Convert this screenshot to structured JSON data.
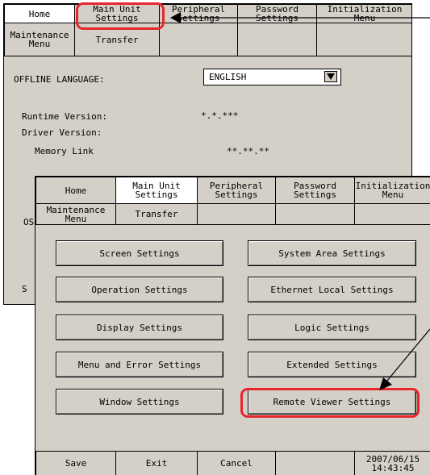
{
  "back": {
    "tabs_row1": [
      "Home",
      "Main Unit\nSettings",
      "Peripheral\nSettings",
      "Password\nSettings",
      "Initialization\nMenu"
    ],
    "tabs_row2": [
      "Maintenance\nMenu",
      "Transfer",
      "",
      "",
      ""
    ],
    "offline_language_label": "OFFLINE LANGUAGE:",
    "offline_language_value": "ENGLISH",
    "runtime_version_label": "Runtime Version:",
    "runtime_version_value": "*.*.***",
    "driver_version_label": "Driver Version:",
    "memory_link_label": "Memory Link",
    "memory_link_value": "**.**.**",
    "os_label_partial": "OS",
    "save_partial": "S"
  },
  "front": {
    "tabs_row1": [
      "Home",
      "Main Unit\nSettings",
      "Peripheral\nSettings",
      "Password\nSettings",
      "Initialization\nMenu"
    ],
    "tabs_row2": [
      "Maintenance\nMenu",
      "Transfer",
      "",
      "",
      ""
    ],
    "buttons_left": [
      "Screen Settings",
      "Operation Settings",
      "Display Settings",
      "Menu and Error Settings",
      "Window Settings"
    ],
    "buttons_right": [
      "System Area Settings",
      "Ethernet Local Settings",
      "Logic Settings",
      "Extended Settings",
      "Remote Viewer Settings"
    ],
    "footer": {
      "save": "Save",
      "exit": "Exit",
      "cancel": "Cancel",
      "blank": "",
      "datetime": "2007/06/15\n14:43:45"
    }
  },
  "colors": {
    "highlight": "#e8262c",
    "panel": "#d4d0c8"
  }
}
